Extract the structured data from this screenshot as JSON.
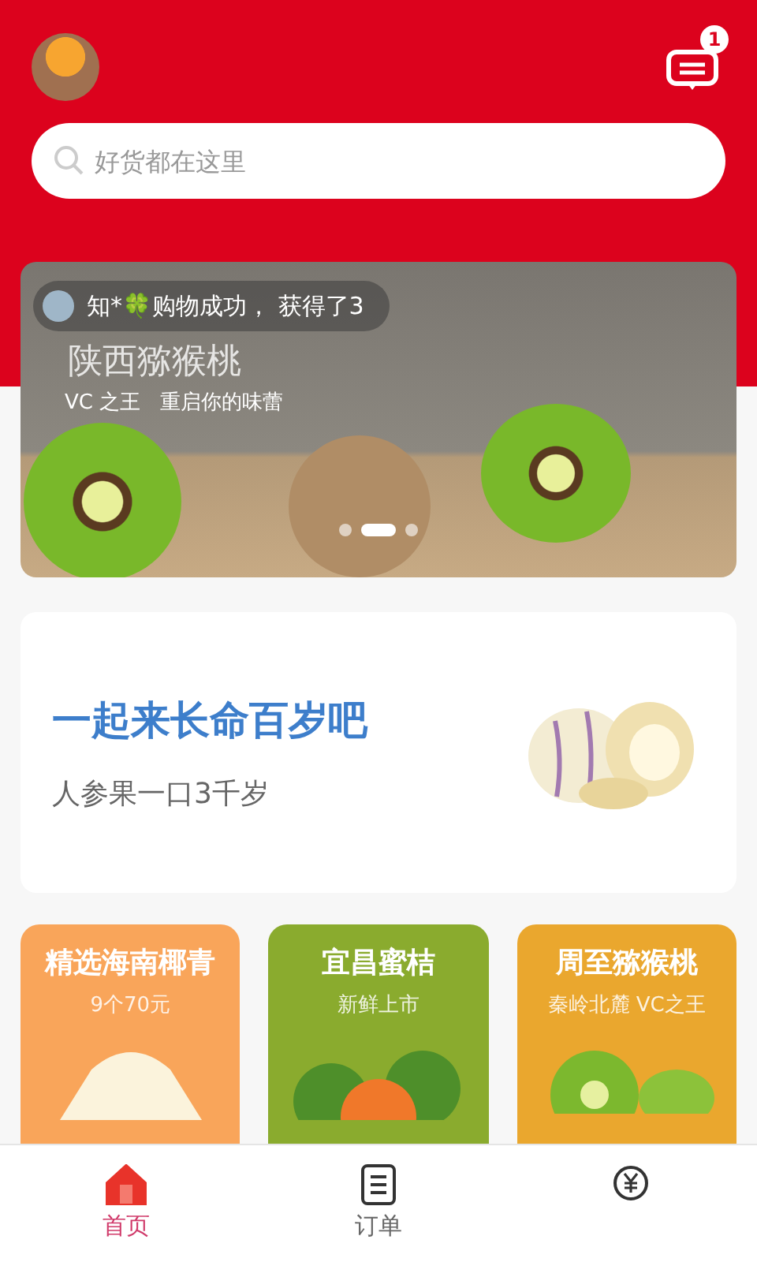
{
  "header": {
    "message_badge": "1"
  },
  "search": {
    "placeholder": "好货都在这里"
  },
  "banner": {
    "notification": "知*🍀购物成功， 获得了3",
    "title": "陕西猕猴桃",
    "subtitle": "VC 之王   重启你的味蕾",
    "dots": [
      {
        "selected": false
      },
      {
        "selected": true
      },
      {
        "selected": false
      }
    ]
  },
  "promo": {
    "title": "一起来长命百岁吧",
    "subtitle": "人参果一口3千岁"
  },
  "products": [
    {
      "kind": "coconut",
      "title": "精选海南椰青",
      "subtitle": "9个70元",
      "color": "#f9a55a"
    },
    {
      "kind": "orange",
      "title": "宜昌蜜桔",
      "subtitle": "新鲜上市",
      "color": "#8aab2e"
    },
    {
      "kind": "kiwi",
      "title": "周至猕猴桃",
      "subtitle": "秦岭北麓 VC之王",
      "color": "#eaa72e"
    }
  ],
  "tabs": [
    {
      "kind": "home",
      "label": "首页",
      "selected": true
    },
    {
      "kind": "orders",
      "label": "订单",
      "selected": false
    },
    {
      "kind": "money",
      "selected": false
    }
  ]
}
